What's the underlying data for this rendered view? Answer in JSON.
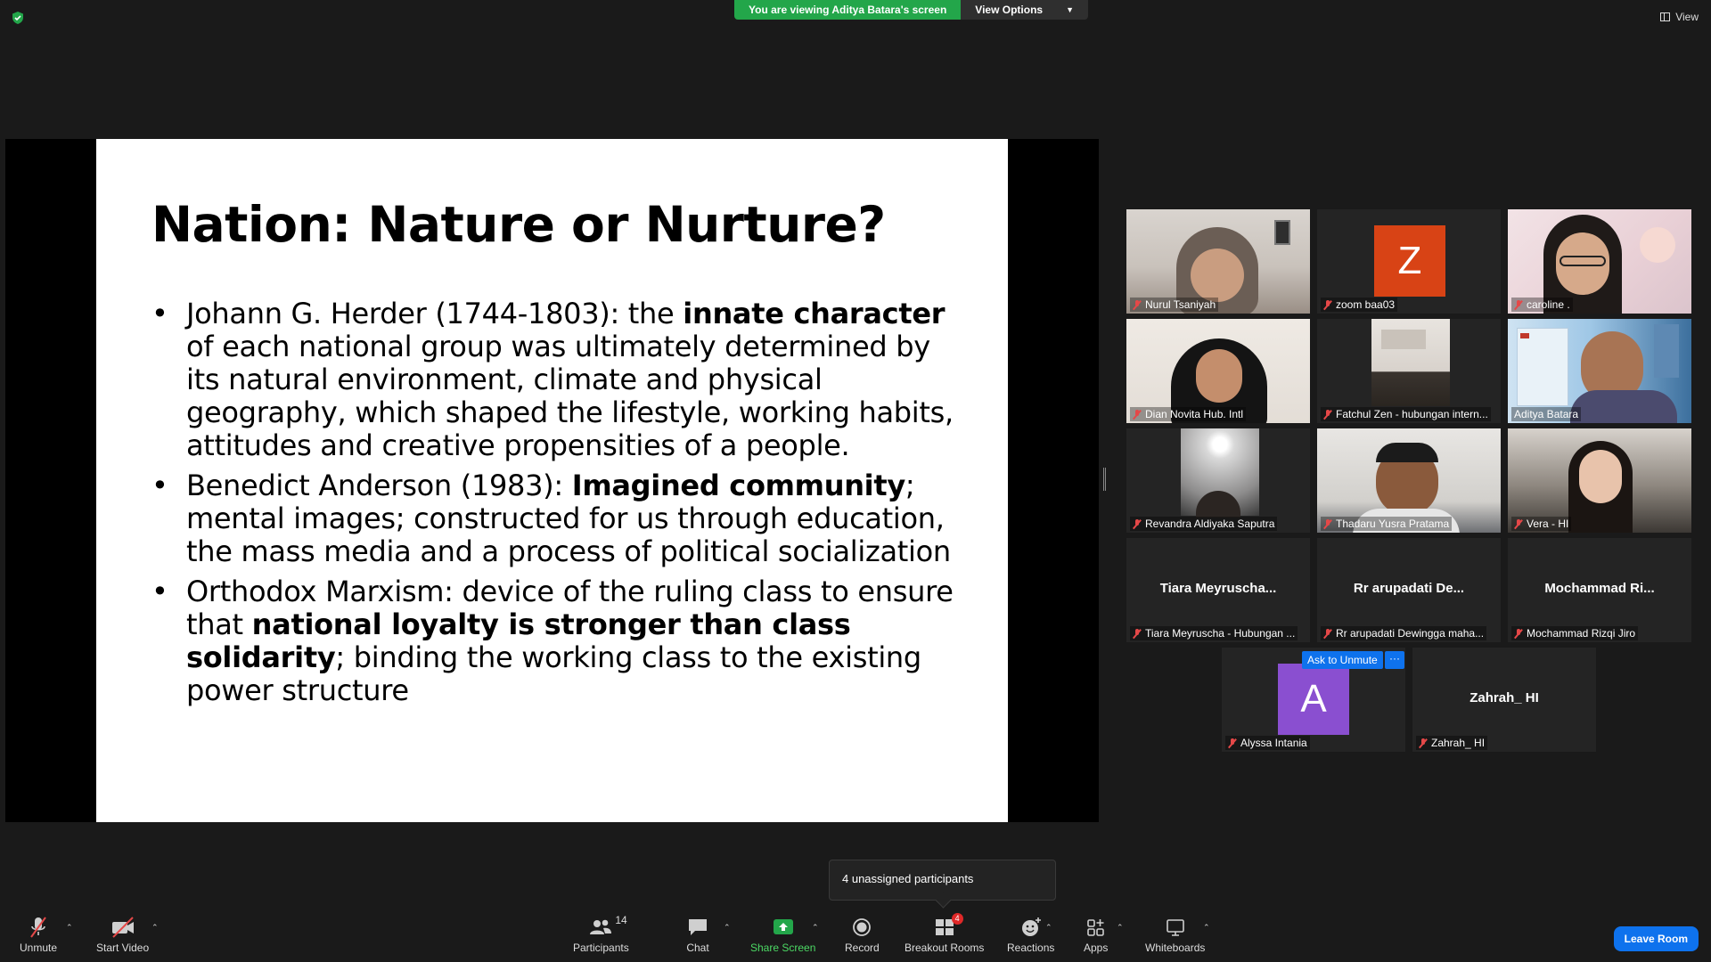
{
  "top": {
    "viewing_text": "You are viewing Aditya Batara's screen",
    "view_options": "View Options",
    "view_label": "View"
  },
  "slide": {
    "title": "Nation: Nature or Nurture?",
    "bullet1": {
      "a": "Johann G. Herder (1744-1803): the ",
      "b": "innate character",
      "c": " of each national group was ultimately determined by its natural environment, climate and physical geography, which shaped the lifestyle, working habits, attitudes and creative propensities of a people."
    },
    "bullet2": {
      "a": "Benedict Anderson (1983): ",
      "b": "Imagined community",
      "c": "; mental images; constructed for us through education, the mass media and a process of political socialization"
    },
    "bullet3": {
      "a": "Orthodox Marxism: device of the ruling class to ensure that ",
      "b": "national loyalty is stronger than class solidarity",
      "c": "; binding the working class to the existing power structure"
    }
  },
  "participants": [
    {
      "name": "Nurul Tsaniyah"
    },
    {
      "name": "zoom baa03",
      "initial": "Z"
    },
    {
      "name": "caroline ."
    },
    {
      "name": "Dian Novita Hub. Intl"
    },
    {
      "name": "Fatchul Zen - hubungan intern..."
    },
    {
      "name": "Aditya Batara"
    },
    {
      "name": "Revandra Aldiyaka Saputra"
    },
    {
      "name": "Thadaru Yusra Pratama"
    },
    {
      "name": "Vera - HI"
    },
    {
      "name": "Tiara Meyruscha - Hubungan ...",
      "display": "Tiara  Meyruscha..."
    },
    {
      "name": "Rr arupadati Dewingga maha...",
      "display": "Rr  arupadati  De..."
    },
    {
      "name": "Mochammad Rizqi Jiro",
      "display": "Mochammad  Ri..."
    },
    {
      "name": "Alyssa Intania",
      "initial": "A"
    },
    {
      "name": "Zahrah_ HI",
      "display": "Zahrah_ HI"
    }
  ],
  "ask_unmute": "Ask to Unmute",
  "more": "···",
  "tooltip": "4 unassigned participants",
  "toolbar": {
    "unmute": "Unmute",
    "start_video": "Start Video",
    "participants": "Participants",
    "participants_count": "14",
    "chat": "Chat",
    "share_screen": "Share Screen",
    "record": "Record",
    "breakout_rooms": "Breakout Rooms",
    "breakout_badge": "4",
    "reactions": "Reactions",
    "apps": "Apps",
    "whiteboards": "Whiteboards",
    "leave_room": "Leave Room"
  },
  "colors": {
    "green": "#23a64a",
    "blue": "#0e72ed",
    "red": "#e54848",
    "active_border": "#e6f06d",
    "zoom_avatar": "#d84315",
    "alyssa_avatar": "#8a4fd0"
  }
}
